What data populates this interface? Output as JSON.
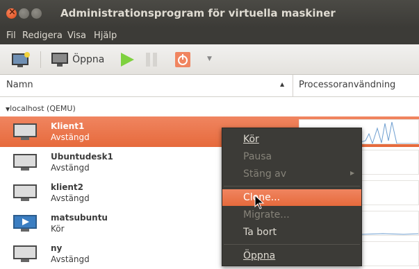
{
  "window": {
    "title": "Administrationsprogram för virtuella maskiner"
  },
  "menubar": [
    "Fil",
    "Redigera",
    "Visa",
    "Hjälp"
  ],
  "toolbar": {
    "open_label": "Öppna"
  },
  "columns": {
    "name": "Namn",
    "cpu": "Processoranvändning"
  },
  "group": "localhost (QEMU)",
  "vms": [
    {
      "name": "Klient1",
      "state": "Avstängd",
      "icon": "monitor-icon"
    },
    {
      "name": "Ubuntudesk1",
      "state": "Avstängd",
      "icon": "monitor-icon"
    },
    {
      "name": "klient2",
      "state": "Avstängd",
      "icon": "monitor-icon"
    },
    {
      "name": "matsubuntu",
      "state": "Kör",
      "icon": "running-icon"
    },
    {
      "name": "ny",
      "state": "Avstängd",
      "icon": "monitor-icon"
    }
  ],
  "context_menu": {
    "run": "Kör",
    "pause": "Pausa",
    "shutdown": "Stäng av",
    "clone": "Clone...",
    "migrate": "Migrate...",
    "delete": "Ta bort",
    "open": "Öppna"
  },
  "colors": {
    "accent": "#e66a3c",
    "menu_bg": "#3c3b37",
    "menu_text": "#dfdbd2"
  }
}
